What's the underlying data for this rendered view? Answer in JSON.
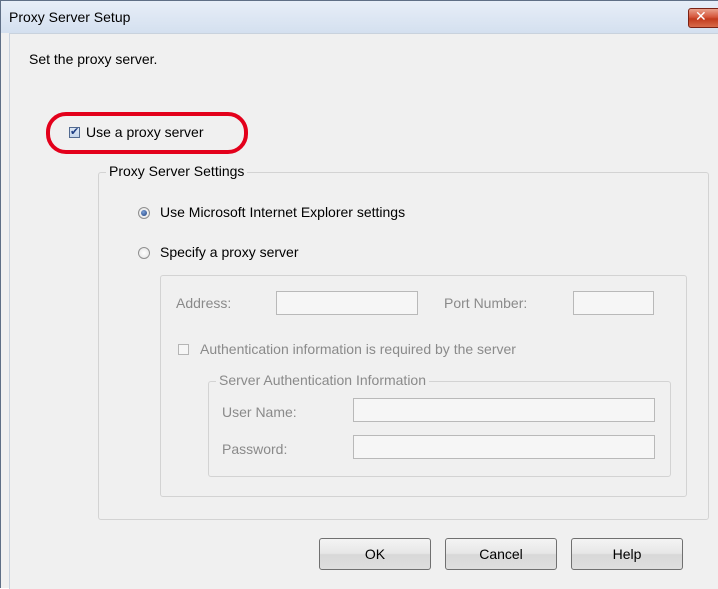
{
  "window": {
    "title": "Proxy Server Setup",
    "close_glyph": "✕"
  },
  "intro": "Set the proxy server.",
  "use_proxy": {
    "label": "Use a proxy server",
    "checked": true
  },
  "proxy_settings": {
    "legend": "Proxy Server Settings",
    "option_ie": "Use Microsoft Internet Explorer settings",
    "option_specify": "Specify a proxy server",
    "selected": "option_ie",
    "address_label": "Address:",
    "address_value": "",
    "port_label": "Port Number:",
    "port_value": "",
    "auth_required_label": "Authentication information is required by the server",
    "auth_required_checked": false,
    "auth_group": {
      "legend": "Server Authentication Information",
      "username_label": "User Name:",
      "username_value": "",
      "password_label": "Password:",
      "password_value": ""
    }
  },
  "buttons": {
    "ok": "OK",
    "cancel": "Cancel",
    "help": "Help"
  },
  "colors": {
    "highlight": "#e3001b",
    "titlebar": "#dbe5f3",
    "close": "#c74a2b"
  }
}
